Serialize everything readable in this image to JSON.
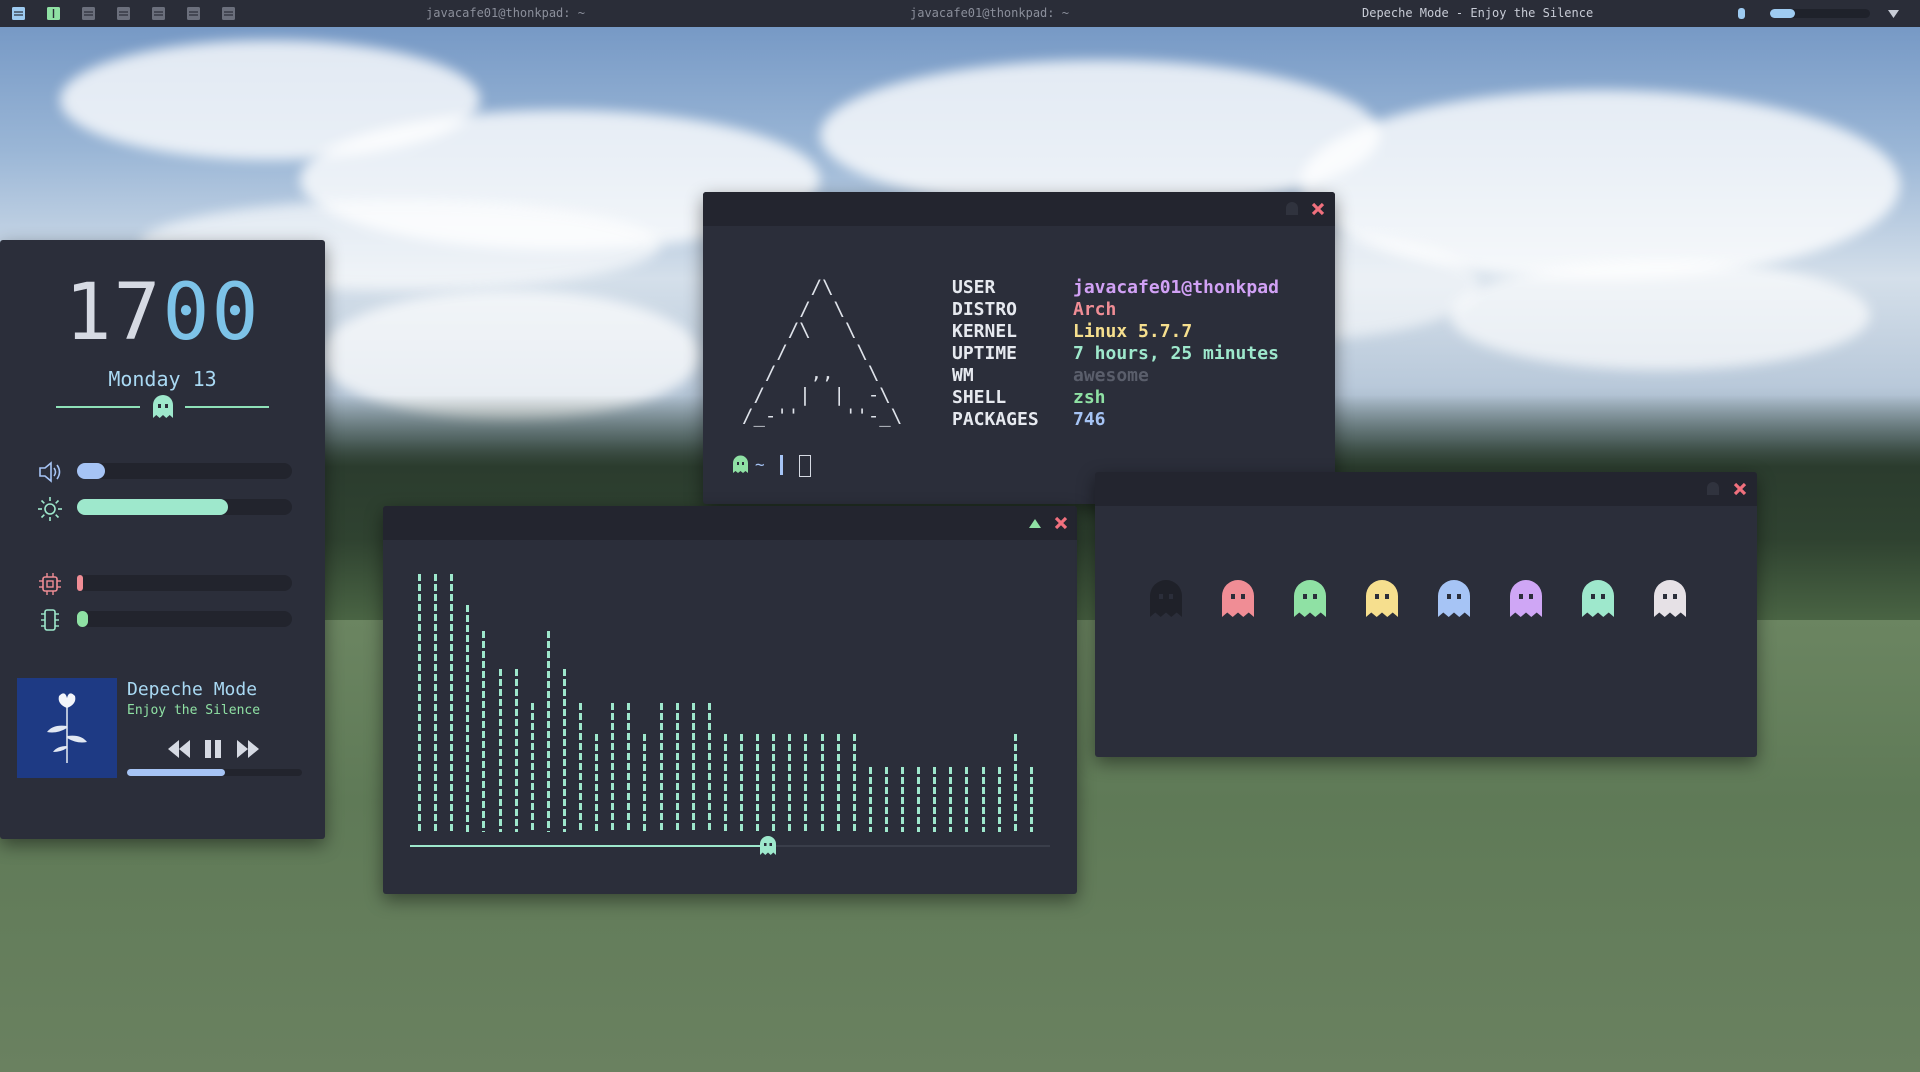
{
  "topbar": {
    "workspaces": [
      "1",
      "2",
      "3",
      "4",
      "5",
      "6",
      "7"
    ],
    "windows": [
      {
        "title": "javacafe01@thonkpad: ~",
        "active": false
      },
      {
        "title": "javacafe01@thonkpad: ~",
        "active": false
      },
      {
        "title": "Depeche Mode - Enjoy the Silence",
        "active": true
      }
    ],
    "volume_level": 0.25
  },
  "dashboard": {
    "clock_hours": "17",
    "clock_minutes": "00",
    "date": "Monday 13",
    "volume": 0.13,
    "brightness": 0.7,
    "cpu": 0.02,
    "ram": 0.05,
    "music": {
      "artist": "Depeche Mode",
      "title": "Enjoy the Silence",
      "progress": 0.56
    }
  },
  "neofetch": {
    "ascii_lines": [
      "      /\\",
      "     /  \\",
      "    /\\   \\",
      "   /      \\",
      "  /   ,,   \\",
      " /   |  |  -\\",
      "/_-''    ''-_\\"
    ],
    "fields": [
      {
        "key": "USER",
        "value": "javacafe01@thonkpad",
        "color": "#d1a1f5"
      },
      {
        "key": "DISTRO",
        "value": "Arch",
        "color": "#f08d95"
      },
      {
        "key": "KERNEL",
        "value": "Linux 5.7.7",
        "color": "#f6df8e"
      },
      {
        "key": "UPTIME",
        "value": "7 hours, 25 minutes",
        "color": "#9ee8cc"
      },
      {
        "key": "WM",
        "value": "awesome",
        "color": "#5a5e6b"
      },
      {
        "key": "SHELL",
        "value": "zsh",
        "color": "#8fe1a4"
      },
      {
        "key": "PACKAGES",
        "value": "746",
        "color": "#a6c4f5"
      }
    ],
    "prompt": "~"
  },
  "visualizer": {
    "levels": [
      1.0,
      1.0,
      1.0,
      0.88,
      0.78,
      0.63,
      0.63,
      0.5,
      0.78,
      0.63,
      0.5,
      0.38,
      0.5,
      0.5,
      0.38,
      0.5,
      0.5,
      0.5,
      0.5,
      0.38,
      0.38,
      0.38,
      0.38,
      0.38,
      0.38,
      0.38,
      0.38,
      0.38,
      0.25,
      0.25,
      0.25,
      0.25,
      0.25,
      0.25,
      0.25,
      0.25,
      0.25,
      0.38,
      0.25
    ],
    "progress": 0.56
  },
  "ghosts": {
    "colors": [
      "#1f2129",
      "#f08d95",
      "#8fe1a4",
      "#f6df8e",
      "#a6c4f5",
      "#cfa6f5",
      "#9ee8cc",
      "#e6e1e6"
    ]
  },
  "colors": {
    "accent_green": "#9ee8cc",
    "accent_blue": "#7dc3e8",
    "close_red": "#f0707d",
    "panel_bg": "#2b2e3a"
  }
}
